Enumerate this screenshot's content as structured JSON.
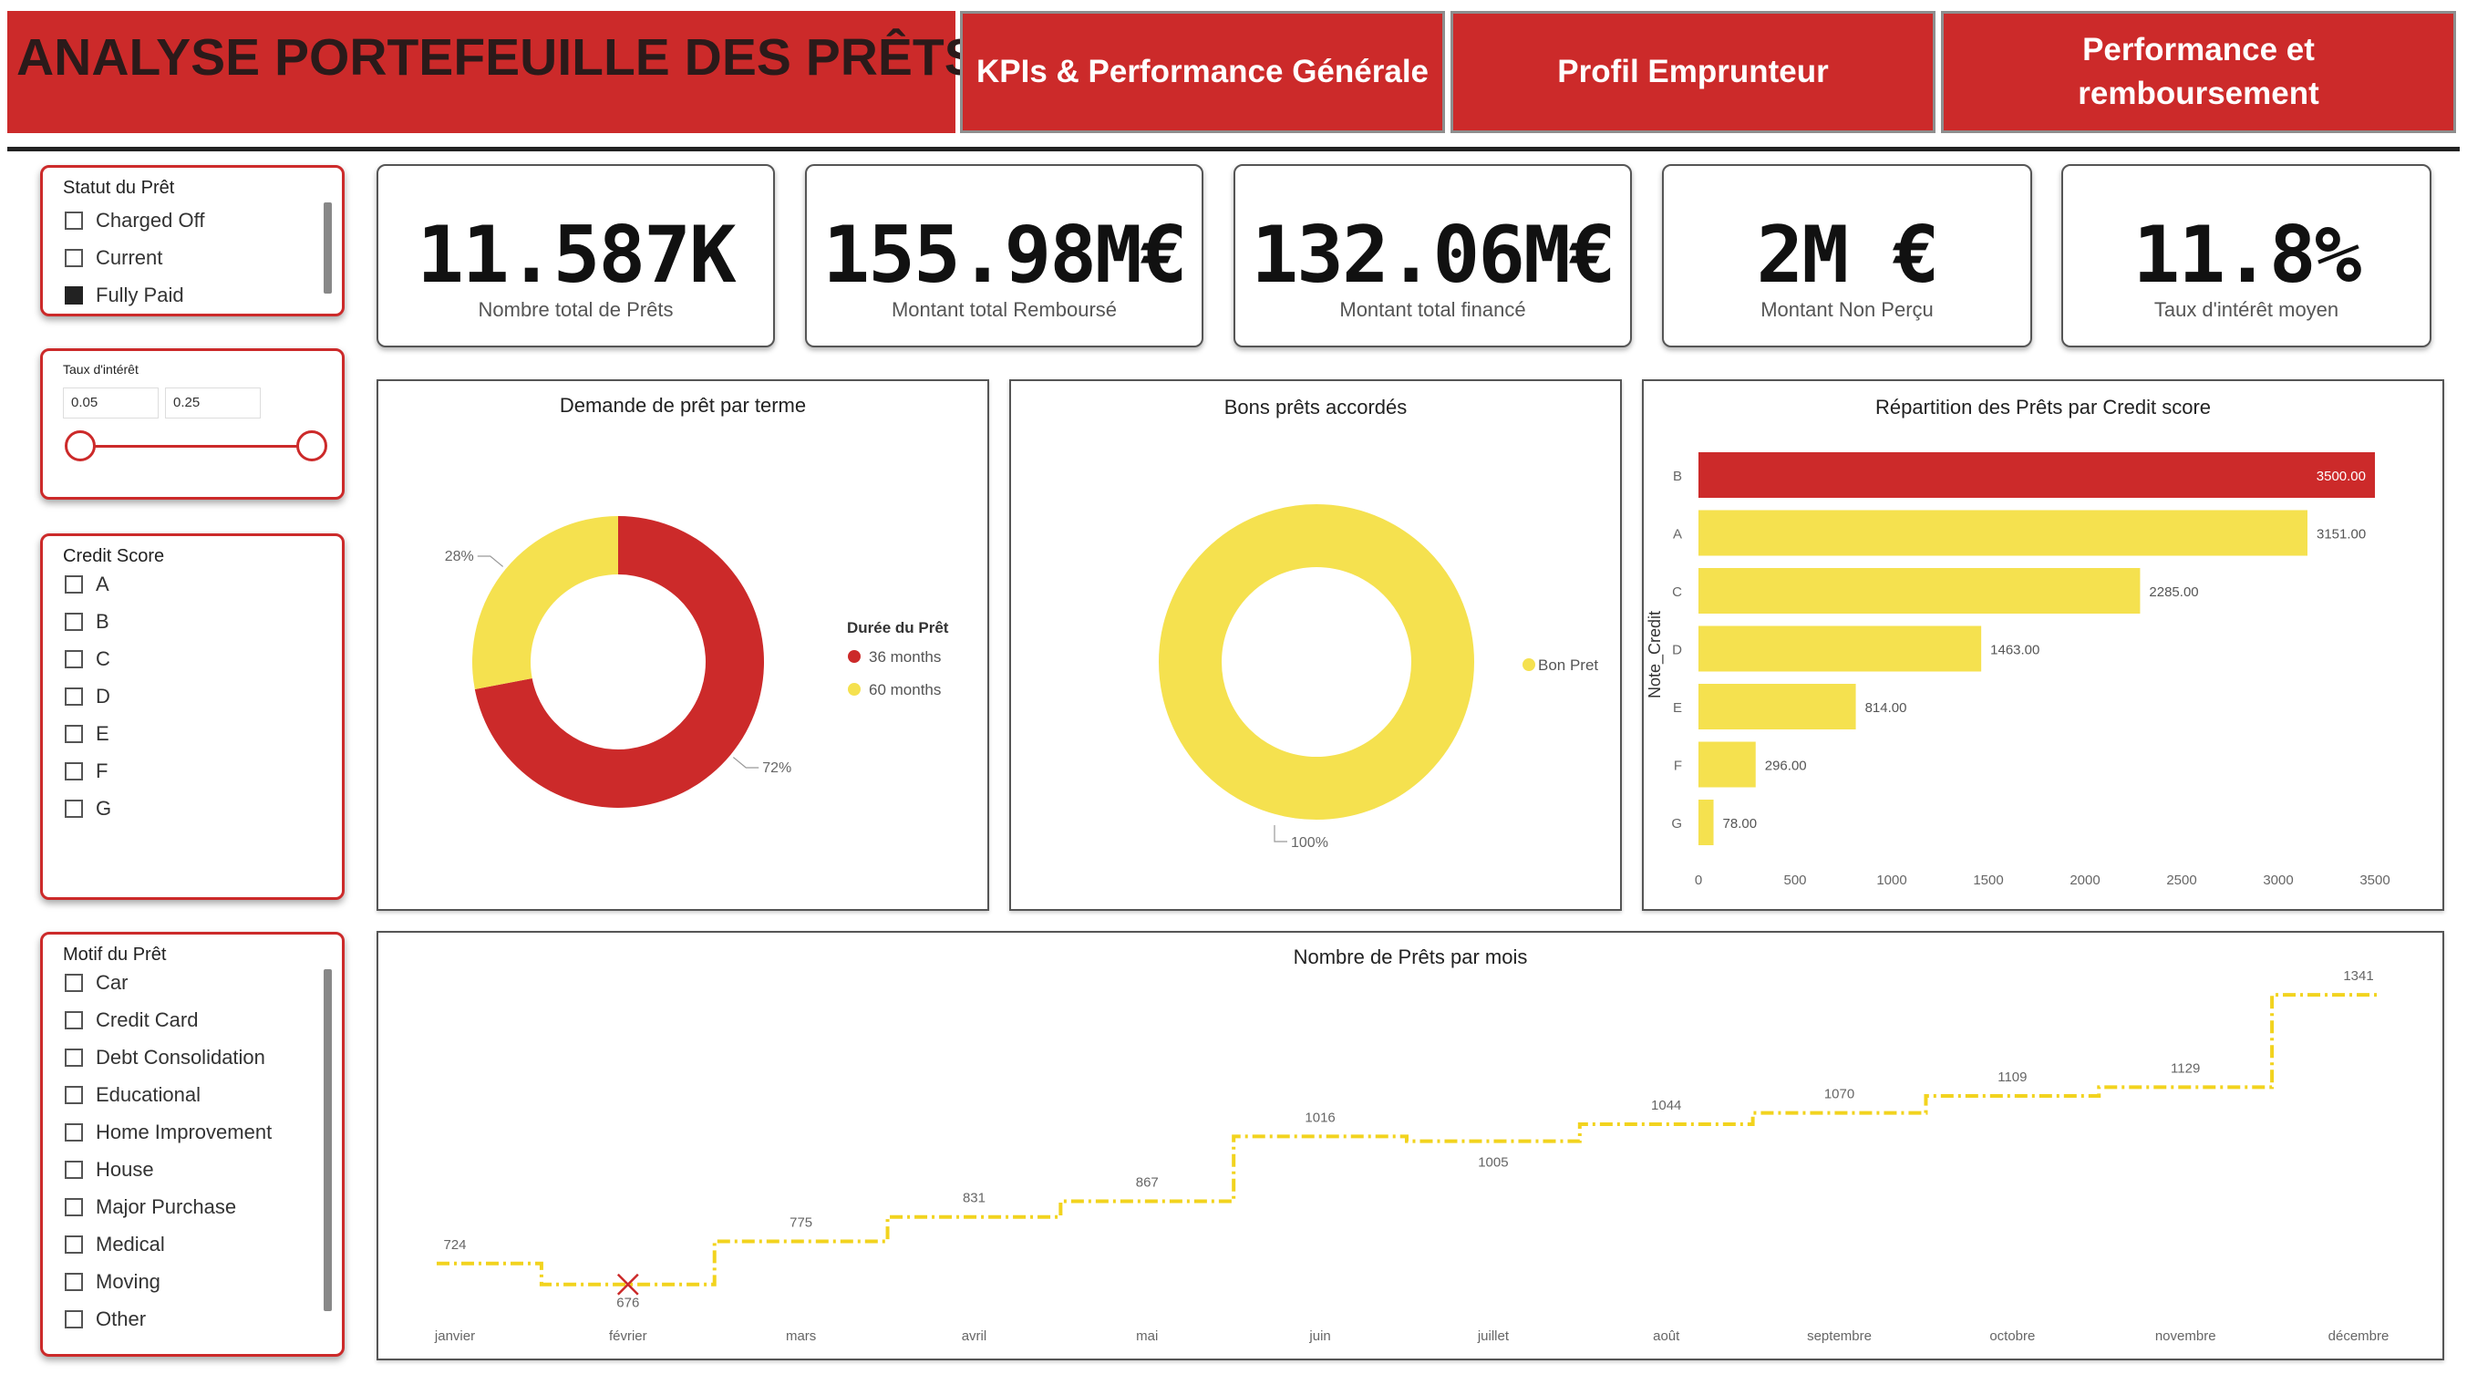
{
  "header": {
    "title": "ANALYSE PORTEFEUILLE DES PRÊTS",
    "nav": [
      "KPIs & Performance Générale",
      "Profil Emprunteur",
      "Performance et remboursement"
    ]
  },
  "filters": {
    "statut": {
      "title": "Statut du Prêt",
      "items": [
        {
          "label": "Charged Off",
          "checked": false
        },
        {
          "label": "Current",
          "checked": false
        },
        {
          "label": "Fully Paid",
          "checked": true
        }
      ]
    },
    "taux": {
      "title": "Taux d'intérêt",
      "min": "0.05",
      "max": "0.25"
    },
    "credit": {
      "title": "Credit Score",
      "items": [
        "A",
        "B",
        "C",
        "D",
        "E",
        "F",
        "G"
      ]
    },
    "motif": {
      "title": "Motif du Prêt",
      "items": [
        "Car",
        "Credit Card",
        "Debt Consolidation",
        "Educational",
        "Home Improvement",
        "House",
        "Major Purchase",
        "Medical",
        "Moving",
        "Other"
      ]
    }
  },
  "kpis": [
    {
      "value": "11.587K",
      "label": "Nombre total de Prêts"
    },
    {
      "value": "155.98M€",
      "label": "Montant total Remboursé"
    },
    {
      "value": "132.06M€",
      "label": "Montant total financé"
    },
    {
      "value": "2M €",
      "label": "Montant Non Perçu"
    },
    {
      "value": "11.8%",
      "label": "Taux d'intérêt moyen"
    }
  ],
  "colors": {
    "red": "#cc2a2a",
    "yellow": "#f5e14f",
    "accent": "#cc2a2a"
  },
  "chart_data": [
    {
      "type": "pie",
      "title": "Demande de prêt par terme",
      "legend_title": "Durée du Prêt",
      "legend_placement": "right",
      "labels": [
        "36 months",
        "60 months"
      ],
      "values": [
        72,
        28
      ],
      "value_labels": [
        "72%",
        "28%"
      ]
    },
    {
      "type": "pie",
      "title": "Bons prêts accordés",
      "legend_placement": "right",
      "labels": [
        "Bon Pret"
      ],
      "values": [
        100
      ],
      "value_labels": [
        "100%"
      ]
    },
    {
      "type": "bar",
      "orientation": "horizontal",
      "title": "Répartition des Prêts par Credit score",
      "ylabel": "Note_Credit",
      "categories": [
        "B",
        "A",
        "C",
        "D",
        "E",
        "F",
        "G"
      ],
      "values": [
        3500,
        3151,
        2285,
        1463,
        814,
        296,
        78
      ],
      "value_labels": [
        "3500.00",
        "3151.00",
        "2285.00",
        "1463.00",
        "814.00",
        "296.00",
        "78.00"
      ],
      "xlim": [
        0,
        3500
      ],
      "xticks": [
        "0",
        "500",
        "1000",
        "1500",
        "2000",
        "2500",
        "3000",
        "3500"
      ]
    },
    {
      "type": "line",
      "step": true,
      "title": "Nombre de Prêts par mois",
      "categories": [
        "janvier",
        "février",
        "mars",
        "avril",
        "mai",
        "juin",
        "juillet",
        "août",
        "septembre",
        "octobre",
        "novembre",
        "décembre"
      ],
      "values": [
        724,
        676,
        775,
        831,
        867,
        1016,
        1005,
        1044,
        1070,
        1109,
        1129,
        1341
      ],
      "value_labels": [
        "724",
        "676",
        "775",
        "831",
        "867",
        "1016",
        "1005",
        "1044",
        "1070",
        "1109",
        "1129",
        "1341"
      ]
    }
  ]
}
